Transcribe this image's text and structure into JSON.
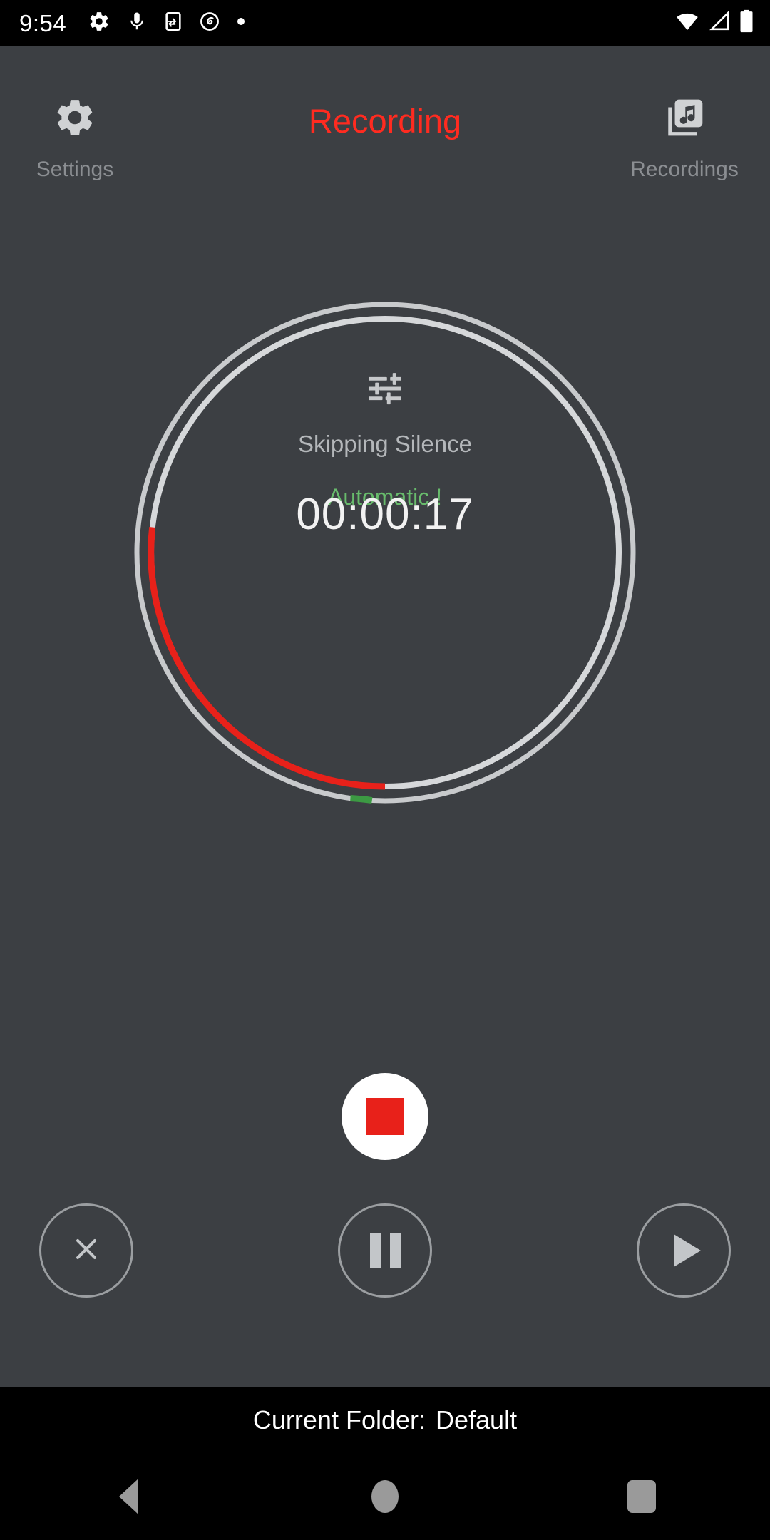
{
  "status_bar": {
    "time": "9:54",
    "left_icons": [
      "gear-icon",
      "microphone-icon",
      "phone-sync-icon",
      "do-not-disturb-icon",
      "dot-icon"
    ],
    "right_icons": [
      "wifi-icon",
      "cellular-signal-icon",
      "battery-icon"
    ]
  },
  "header": {
    "title": "Recording",
    "title_color": "#ff2b20",
    "settings_label": "Settings",
    "settings_icon": "gear-icon",
    "recordings_label": "Recordings",
    "recordings_icon": "music-library-icon"
  },
  "dial": {
    "mode_icon": "tune-sliders-icon",
    "mode_label": "Skipping Silence",
    "mode_value": "Automatic !",
    "mode_value_color": "#68bb6c",
    "timer": "00:00:17",
    "outer_ring_color": "#c8cacc",
    "outer_marker_color": "#3c9a43",
    "inner_ring_color": "#d6d8da",
    "inner_progress_color": "#e8211a"
  },
  "controls": {
    "stop_label": "Stop",
    "stop_icon": "stop-square-icon",
    "stop_icon_color": "#e8211a",
    "cancel_label": "Cancel",
    "cancel_icon": "close-x-icon",
    "pause_label": "Pause",
    "pause_icon": "pause-icon",
    "play_label": "Play",
    "play_icon": "play-icon"
  },
  "footer": {
    "folder_label": "Current Folder:",
    "folder_name": "Default"
  },
  "nav_bar": {
    "back_icon": "back-triangle-icon",
    "home_icon": "home-circle-icon",
    "recents_icon": "recents-square-icon"
  }
}
